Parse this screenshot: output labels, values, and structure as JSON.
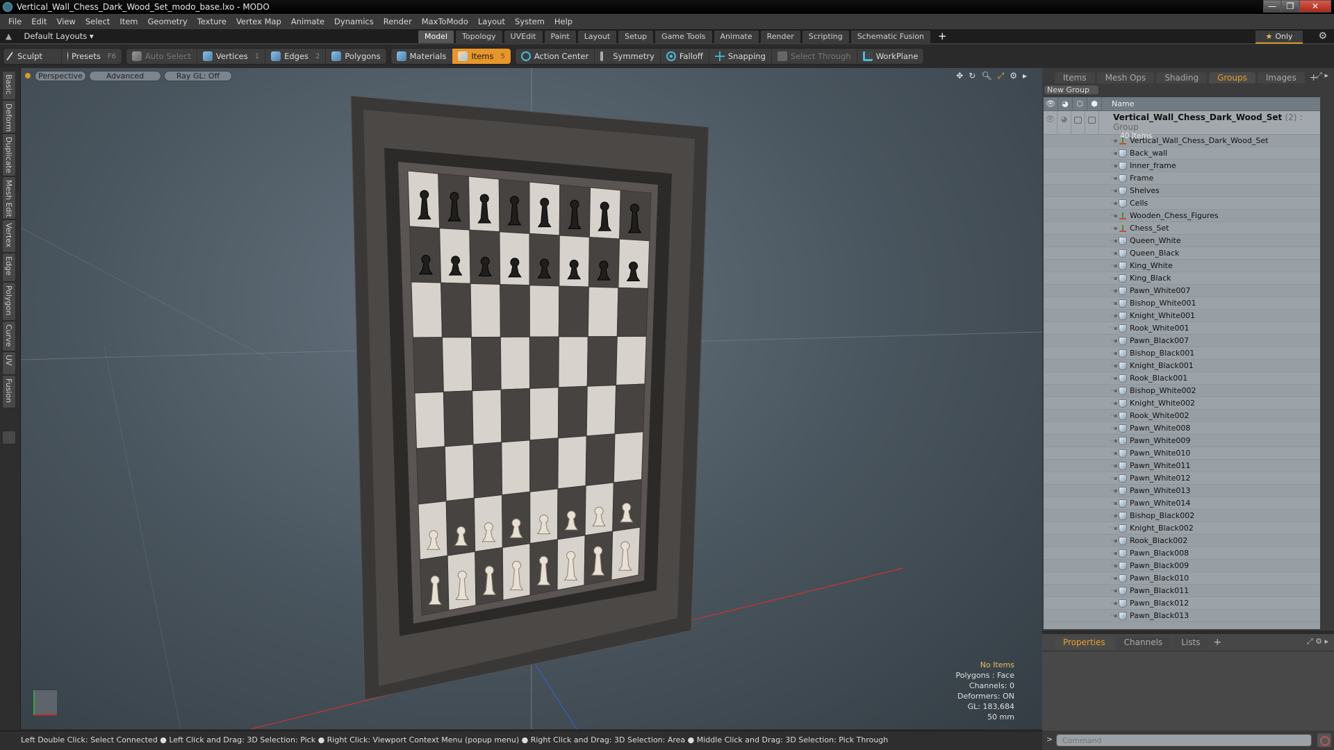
{
  "window": {
    "title": "Vertical_Wall_Chess_Dark_Wood_Set_modo_base.lxo - MODO",
    "controls": [
      "minimize",
      "restore",
      "close"
    ]
  },
  "menubar": [
    "File",
    "Edit",
    "View",
    "Select",
    "Item",
    "Geometry",
    "Texture",
    "Vertex Map",
    "Animate",
    "Dynamics",
    "Render",
    "MaxToModo",
    "Layout",
    "System",
    "Help"
  ],
  "layoutbar": {
    "layout_selector": "Default Layouts",
    "tabs": [
      "Model",
      "Topology",
      "UVEdit",
      "Paint",
      "Layout",
      "Setup",
      "Game Tools",
      "Animate",
      "Render",
      "Scripting",
      "Schematic Fusion"
    ],
    "active_tab": "Model",
    "only_label": "Only"
  },
  "toolbar": {
    "sculpt": "Sculpt",
    "presets": "Presets",
    "presets_key": "F6",
    "auto_select": "Auto Select",
    "vertices": "Vertices",
    "vertices_key": "1",
    "edges": "Edges",
    "edges_key": "2",
    "polygons": "Polygons",
    "materials": "Materials",
    "items": "Items",
    "items_key": "5",
    "action_center": "Action Center",
    "symmetry": "Symmetry",
    "falloff": "Falloff",
    "snapping": "Snapping",
    "select_through": "Select Through",
    "workplane": "WorkPlane"
  },
  "left_tabs": [
    "Basic",
    "Deform",
    "Duplicate",
    "Mesh Edit",
    "Vertex",
    "Edge",
    "Polygon",
    "Curve",
    "UV",
    "Fusion"
  ],
  "viewport": {
    "view_mode": "Perspective",
    "shading": "Advanced",
    "raygl": "Ray GL: Off",
    "info": {
      "selection": "No Items",
      "polygons": "Polygons : Face",
      "channels": "Channels: 0",
      "deformers": "Deformers: ON",
      "gl": "GL: 183,684",
      "focal": "50 mm"
    }
  },
  "right_panel": {
    "tabs": [
      "Items",
      "Mesh Ops",
      "Shading",
      "Groups",
      "Images"
    ],
    "active_tab": "Groups",
    "new_group": "New Group",
    "name_header": "Name",
    "group": {
      "name": "Vertical_Wall_Chess_Dark_Wood_Set",
      "count": "(2)",
      "type": ": Group",
      "sub": "40 Items"
    },
    "items": [
      {
        "name": "Vertical_Wall_Chess_Dark_Wood_Set",
        "icon": "locator"
      },
      {
        "name": "Back_wall",
        "icon": "mesh"
      },
      {
        "name": "Inner_frame",
        "icon": "mesh"
      },
      {
        "name": "Frame",
        "icon": "mesh"
      },
      {
        "name": "Shelves",
        "icon": "mesh"
      },
      {
        "name": "Cells",
        "icon": "mesh"
      },
      {
        "name": "Wooden_Chess_Figures",
        "icon": "locator"
      },
      {
        "name": "Chess_Set",
        "icon": "locator"
      },
      {
        "name": "Queen_White",
        "icon": "mesh"
      },
      {
        "name": "Queen_Black",
        "icon": "mesh"
      },
      {
        "name": "King_White",
        "icon": "mesh"
      },
      {
        "name": "King_Black",
        "icon": "mesh"
      },
      {
        "name": "Pawn_White007",
        "icon": "mesh"
      },
      {
        "name": "Bishop_White001",
        "icon": "mesh"
      },
      {
        "name": "Knight_White001",
        "icon": "mesh"
      },
      {
        "name": "Rook_White001",
        "icon": "mesh"
      },
      {
        "name": "Pawn_Black007",
        "icon": "mesh"
      },
      {
        "name": "Bishop_Black001",
        "icon": "mesh"
      },
      {
        "name": "Knight_Black001",
        "icon": "mesh"
      },
      {
        "name": "Rook_Black001",
        "icon": "mesh"
      },
      {
        "name": "Bishop_White002",
        "icon": "mesh"
      },
      {
        "name": "Knight_White002",
        "icon": "mesh"
      },
      {
        "name": "Rook_White002",
        "icon": "mesh"
      },
      {
        "name": "Pawn_White008",
        "icon": "mesh"
      },
      {
        "name": "Pawn_White009",
        "icon": "mesh"
      },
      {
        "name": "Pawn_White010",
        "icon": "mesh"
      },
      {
        "name": "Pawn_White011",
        "icon": "mesh"
      },
      {
        "name": "Pawn_White012",
        "icon": "mesh"
      },
      {
        "name": "Pawn_White013",
        "icon": "mesh"
      },
      {
        "name": "Pawn_White014",
        "icon": "mesh"
      },
      {
        "name": "Bishop_Black002",
        "icon": "mesh"
      },
      {
        "name": "Knight_Black002",
        "icon": "mesh"
      },
      {
        "name": "Rook_Black002",
        "icon": "mesh"
      },
      {
        "name": "Pawn_Black008",
        "icon": "mesh"
      },
      {
        "name": "Pawn_Black009",
        "icon": "mesh"
      },
      {
        "name": "Pawn_Black010",
        "icon": "mesh"
      },
      {
        "name": "Pawn_Black011",
        "icon": "mesh"
      },
      {
        "name": "Pawn_Black012",
        "icon": "mesh"
      },
      {
        "name": "Pawn_Black013",
        "icon": "mesh"
      }
    ]
  },
  "properties_panel": {
    "tabs": [
      "Properties",
      "Channels",
      "Lists"
    ],
    "active_tab": "Properties"
  },
  "statusbar": {
    "hint": "Left Double Click: Select Connected ● Left Click and Drag: 3D Selection: Pick ● Right Click: Viewport Context Menu (popup menu) ● Right Click and Drag: 3D Selection: Area ● Middle Click and Drag: 3D Selection: Pick Through"
  },
  "command": {
    "prompt": ">",
    "placeholder": "Command"
  },
  "colors": {
    "accent": "#e7962c",
    "active_tab_text": "#e8a030",
    "info_highlight": "#e8c060"
  }
}
